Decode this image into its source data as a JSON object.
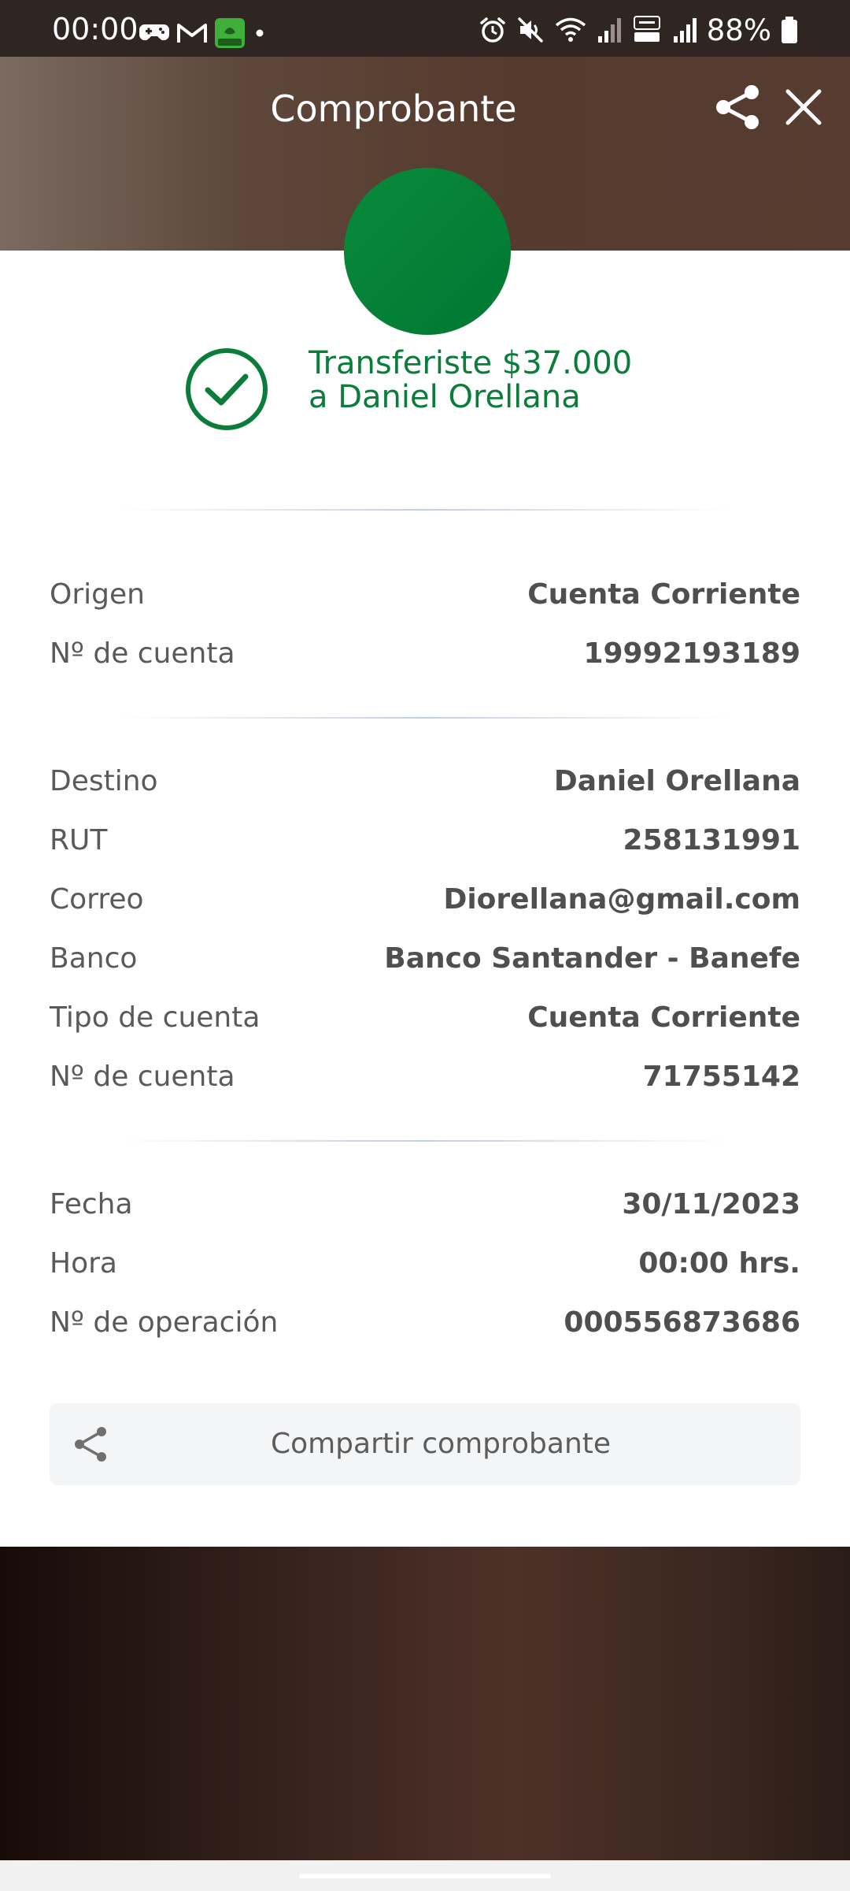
{
  "status_bar": {
    "time": "00:00",
    "battery": "88%"
  },
  "header": {
    "title": "Comprobante"
  },
  "success": {
    "line1": "Transferiste $37.000",
    "line2": "a Daniel Orellana"
  },
  "origin": [
    {
      "label": "Origen",
      "value": "Cuenta Corriente"
    },
    {
      "label": "Nº de cuenta",
      "value": "19992193189"
    }
  ],
  "destination": [
    {
      "label": "Destino",
      "value": "Daniel Orellana"
    },
    {
      "label": "RUT",
      "value": "258131991"
    },
    {
      "label": "Correo",
      "value": "Diorellana@gmail.com"
    },
    {
      "label": "Banco",
      "value": "Banco Santander - Banefe"
    },
    {
      "label": "Tipo de cuenta",
      "value": "Cuenta Corriente"
    },
    {
      "label": "Nº de cuenta",
      "value": "71755142"
    }
  ],
  "operation": [
    {
      "label": "Fecha",
      "value": "30/11/2023"
    },
    {
      "label": "Hora",
      "value": "00:00 hrs."
    },
    {
      "label": "Nº de operación",
      "value": "000556873686"
    }
  ],
  "share_button": {
    "label": "Compartir comprobante"
  },
  "colors": {
    "brand_green": "#0a7d3a",
    "header_brown": "#553b2e",
    "status_bar": "#2f2622"
  }
}
